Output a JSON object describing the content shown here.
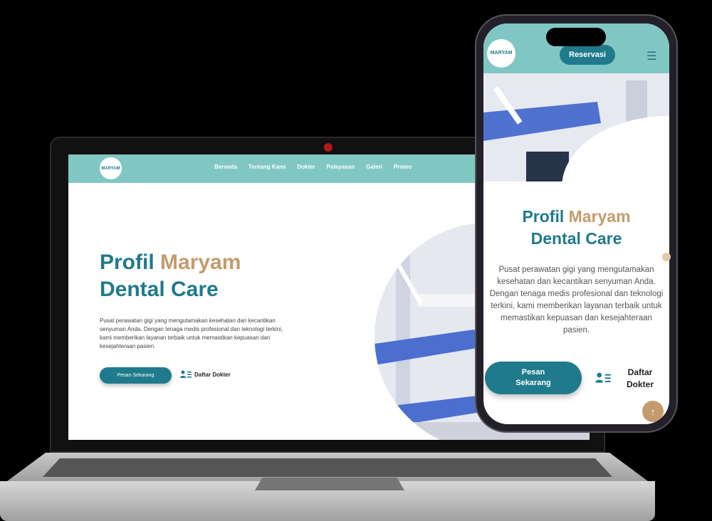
{
  "brand": {
    "logo_text": "MARYAM",
    "colors": {
      "teal": "#1f7a8c",
      "nav": "#80c7c4",
      "accent": "#c49b6c"
    }
  },
  "desktop": {
    "nav": [
      "Beranda",
      "Tentang Kami",
      "Dokter",
      "Pelayanan",
      "Galeri",
      "Promo"
    ],
    "title_part1": "Profil ",
    "title_accent": "Maryam",
    "title_part2": "Dental Care",
    "description": "Pusat perawatan gigi yang mengutamakan kesehatan dan kecantikan senyuman Anda. Dengan tenaga medis profesional dan teknologi terkini, kami memberikan layanan terbaik untuk memastikan kepuasan dan kesejahteraan pasien.",
    "primary_button": "Pesan Sekarang",
    "secondary_link": "Daftar Dokter"
  },
  "mobile": {
    "reserve_button": "Reservasi",
    "menu_icon": "hamburger-icon",
    "title_part1": "Profil ",
    "title_accent": "Maryam",
    "title_part2": "Dental Care",
    "description": "Pusat perawatan gigi yang mengutamakan kesehatan dan kecantikan senyuman Anda. Dengan tenaga medis profesional dan teknologi terkini, kami memberikan layanan terbaik untuk memastikan kepuasan dan kesejahteraan pasien.",
    "primary_button": "Pesan Sekarang",
    "secondary_link": "Daftar Dokter",
    "scroll_top_icon": "arrow-up-icon"
  }
}
